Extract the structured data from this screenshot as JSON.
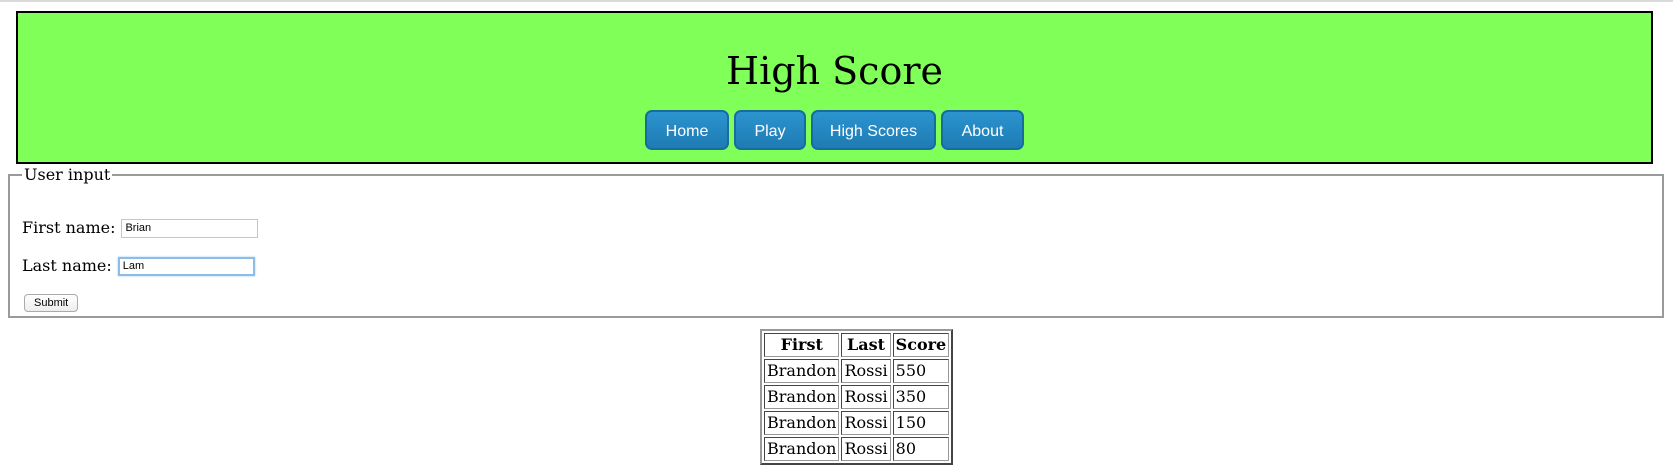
{
  "header": {
    "title": "High Score",
    "nav": [
      "Home",
      "Play",
      "High Scores",
      "About"
    ]
  },
  "form": {
    "legend": "User input",
    "first_label": "First name:",
    "first_value": "Brian",
    "last_label": "Last name:",
    "last_value": "Lam",
    "submit_label": "Submit"
  },
  "table": {
    "headers": [
      "First",
      "Last",
      "Score"
    ],
    "rows": [
      [
        "Brandon",
        "Rossi",
        "550"
      ],
      [
        "Brandon",
        "Rossi",
        "350"
      ],
      [
        "Brandon",
        "Rossi",
        "150"
      ],
      [
        "Brandon",
        "Rossi",
        "80"
      ]
    ]
  },
  "colors": {
    "header_bg": "#7fff57",
    "nav_button": "#2189c4"
  }
}
